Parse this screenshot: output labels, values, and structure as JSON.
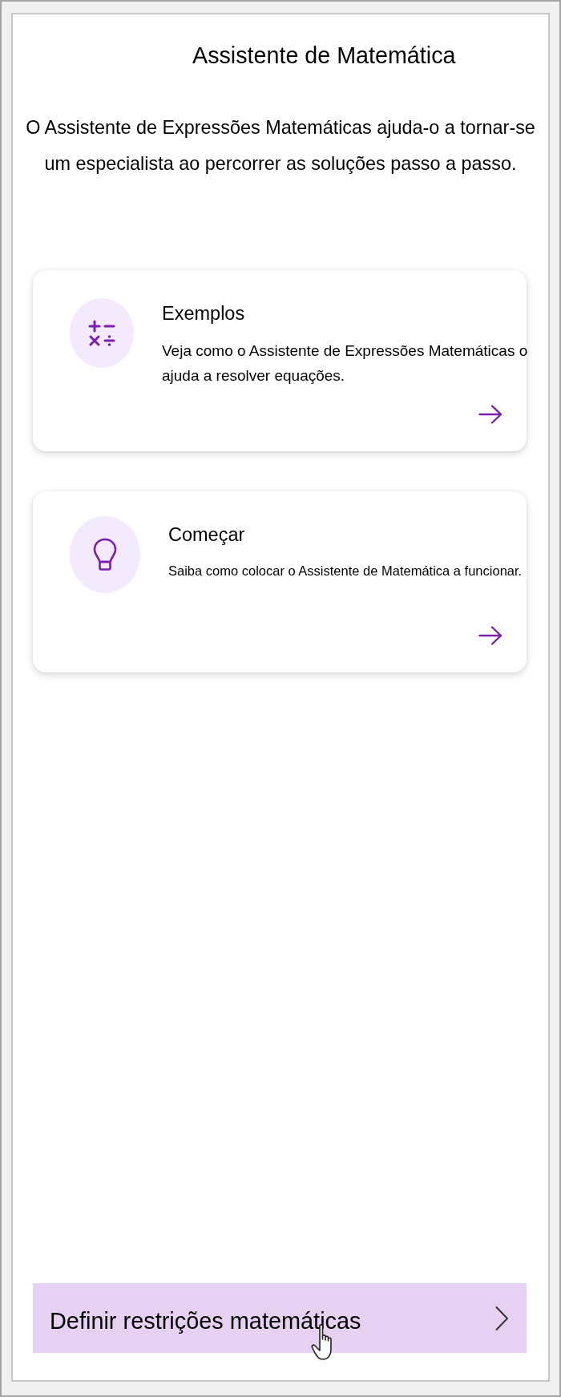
{
  "panel": {
    "title": "Assistente de Matemática",
    "intro": "O Assistente de Expressões Matemáticas ajuda-o a tornar-se um especialista ao percorrer as soluções passo a passo."
  },
  "cards": [
    {
      "kind": "operators",
      "title": "Exemplos",
      "description": "Veja como o Assistente de Expressões Matemáticas o ajuda a resolver equações."
    },
    {
      "kind": "lightbulb",
      "title": "Começar",
      "description": "Saiba como colocar o Assistente de Matemática a funcionar."
    }
  ],
  "footer_button": {
    "label": "Definir restrições matemáticas"
  }
}
